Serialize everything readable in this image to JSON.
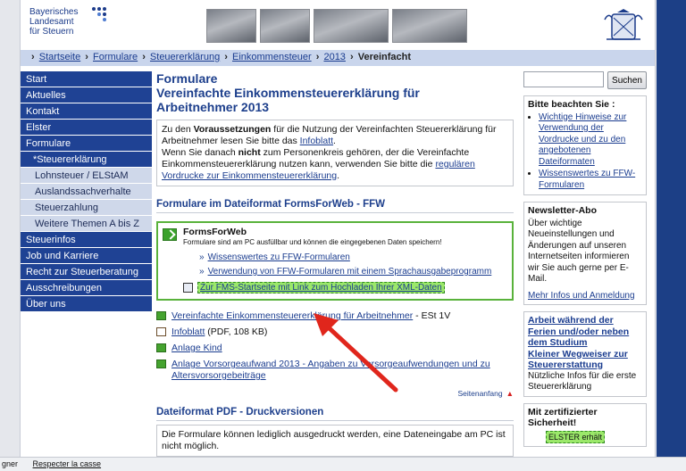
{
  "header": {
    "logo_line1": "Bayerisches",
    "logo_line2": "Landesamt",
    "logo_line3": "für Steuern"
  },
  "breadcrumb": {
    "items": [
      "Startseite",
      "Formulare",
      "Steuererklärung",
      "Einkommensteuer",
      "2013"
    ],
    "current": "Vereinfacht"
  },
  "nav": {
    "items": [
      {
        "label": "Start"
      },
      {
        "label": "Aktuelles"
      },
      {
        "label": "Kontakt"
      },
      {
        "label": "Elster"
      },
      {
        "label": "Formulare"
      },
      {
        "label": "*Steuererklärung"
      },
      {
        "label": "Lohnsteuer / ELStAM"
      },
      {
        "label": "Auslandssachverhalte"
      },
      {
        "label": "Steuerzahlung"
      },
      {
        "label": "Weitere Themen A bis Z"
      },
      {
        "label": "Steuerinfos"
      },
      {
        "label": "Job und Karriere"
      },
      {
        "label": "Recht zur Steuerberatung"
      },
      {
        "label": "Ausschreibungen"
      },
      {
        "label": "Über uns"
      }
    ]
  },
  "main": {
    "title_line1": "Formulare",
    "title_line2": "Vereinfachte Einkommensteuererklärung für",
    "title_line3": "Arbeitnehmer 2013",
    "info": {
      "t1": "Zu den ",
      "b1": "Voraussetzungen",
      "t2": " für die Nutzung der Vereinfachten Steuererklärung für Arbeitnehmer lesen Sie bitte das ",
      "link1": "Infoblatt",
      "t3": ".",
      "t4": "Wenn Sie danach ",
      "b2": "nicht",
      "t5": " zum Personenkreis gehören, der die Vereinfachte Einkommensteuererklärung nutzen kann, verwenden Sie bitte die ",
      "link2": "regulären Vordrucke zur Einkommensteuererklärung",
      "t6": "."
    },
    "ffw_heading": "Formulare im Dateiformat FormsForWeb - FFW",
    "ffw": {
      "title": "FormsForWeb",
      "desc": "Formulare sind am PC ausfüllbar und können die eingegebenen Daten speichern!",
      "link1": "Wissenswertes zu FFW-Formularen",
      "link2": "Verwendung von FFW-Formularen mit einem Sprachausgabeprogramm",
      "link3": "Zur FMS-Startseite mit Link zum Hochladen Ihrer XML-Daten"
    },
    "files": [
      {
        "label": "Vereinfachte Einkommensteuererklärung für Arbeitnehmer",
        "suffix": " - ESt 1V"
      },
      {
        "label": "Infoblatt",
        "suffix": " (PDF, 108 KB)"
      },
      {
        "label": "Anlage Kind",
        "suffix": ""
      },
      {
        "label": "Anlage Vorsorgeaufwand 2013 - Angaben zu Vorsorgeaufwendungen und zu Altersvorsorgebeiträge",
        "suffix": ""
      }
    ],
    "top_link": "Seitenanfang",
    "pdf_heading": "Dateiformat PDF - Druckversionen",
    "pdf_text": "Die Formulare können lediglich ausgedruckt werden, eine Dateneingabe am PC ist nicht möglich."
  },
  "right": {
    "search_value": "",
    "search_button": "Suchen",
    "notice_heading": "Bitte beachten Sie :",
    "notice_items": [
      "Wichtige Hinweise zur Verwendung der Vordrucke und zu den angebotenen Dateiformaten",
      "Wissenswertes zu FFW-Formularen"
    ],
    "newsletter_heading": "Newsletter-Abo",
    "newsletter_text": "Über wichtige Neueinstellungen und Änderungen auf unseren Internetseiten informieren wir Sie auch gerne per E-Mail.",
    "newsletter_link": "Mehr Infos und Anmeldung",
    "work_link1": "Arbeit während der Ferien und/oder neben dem Studium",
    "work_link2": "Kleiner Wegweiser zur Steuererstattung",
    "work_text": "Nützliche Infos für die erste Steuererklärung",
    "cert_heading": "Mit zertifizierter Sicherheit!",
    "cert_badge": "ELSTER erhält"
  },
  "statusbar": {
    "left": "gner",
    "item": "Respecter la casse"
  }
}
